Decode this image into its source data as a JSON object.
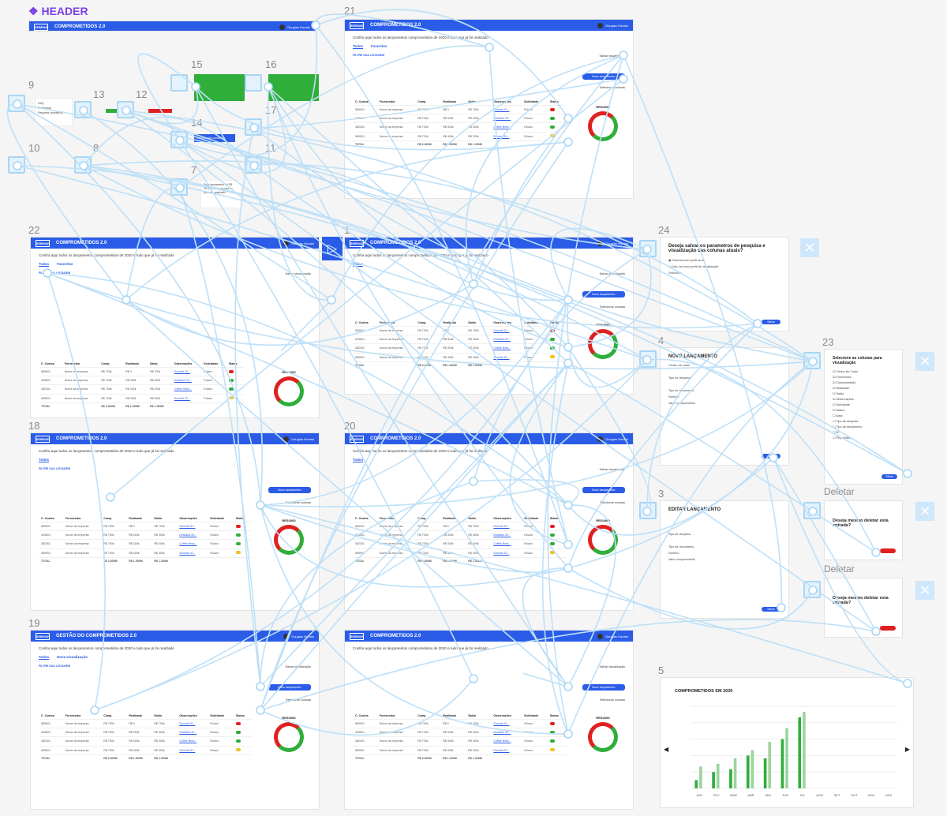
{
  "header_label": "HEADER",
  "frame_numbers": [
    "21",
    "22",
    "1",
    "24",
    "4",
    "23",
    "18",
    "20",
    "3",
    "19",
    "5",
    "9",
    "13",
    "12",
    "15",
    "16",
    "17",
    "14",
    "10",
    "8",
    "11",
    "7"
  ],
  "app": {
    "title": "COMPROMETIDOS 2.0",
    "title_alt": "GESTÃO DO COMPROMETIDOS 2.0",
    "logo": "SEBRAE",
    "user": "Douglas Honato",
    "intro": "Confira aqui todos os lançamentos comprometidos de 2020 e tudo que já foi realizado",
    "tabs": [
      "Todos",
      "Favoritos"
    ],
    "tab_alt": "Nova visualização",
    "filter_label": "FILTRE SUA LISTAGEM",
    "save_view": "Salvar visualização",
    "new_entry": "Novo lançamento",
    "select_columns": "Selecionar colunas",
    "filter_fields": [
      "Proprietários",
      "Status",
      "Tipo de despesa e lançamento"
    ],
    "chip_value": "64390x",
    "status_value": "Atendimento",
    "more_filters": "Filtros avançados",
    "columns": [
      "C. Custos",
      "Fornecedor",
      "Comp.",
      "Realizado",
      "Saldo",
      "Observações",
      "Solicitante",
      "Status"
    ],
    "rows": [
      {
        "cc": "589901",
        "forn": "Nome da empresa",
        "comp": "R$ 700k",
        "real": "R$ 0",
        "saldo": "R$ 700k",
        "obs": "Summit 20...",
        "sol": "Fulano",
        "status": "#e02020"
      },
      {
        "cc": "425601",
        "forn": "Nome da empresa",
        "comp": "R$ 700k",
        "real": "R$ 300k",
        "saldo": "R$ 400k",
        "obs": "Desafios 20...",
        "sol": "Fulano",
        "status": "#2fae3a"
      },
      {
        "cc": "382261",
        "forn": "Nome da empresa",
        "comp": "R$ 700k",
        "real": "R$ 300k",
        "saldo": "R$ 400k",
        "obs": "Coffee Brea...",
        "sol": "Fulano",
        "status": "#2fae3a"
      },
      {
        "cc": "589901",
        "forn": "Nome da empresa",
        "comp": "R$ 700k",
        "real": "R$ 400k",
        "saldo": "R$ 300k",
        "obs": "Summit 20...",
        "sol": "Fulano",
        "status": "#f0c020"
      }
    ],
    "total_label": "TOTAL",
    "totals": [
      "R$ 2.800M",
      "R$ 1.500M",
      "R$ 1.300M"
    ],
    "resumo": "RESUMO",
    "donut_label": "75%",
    "visao": "Visão Geral"
  },
  "dialogs": {
    "save_params": "Deseja salvar os parametros de pesquisa e visualização das colunas atuais?",
    "save_opt1": "Sobrescrever perfil atual",
    "save_opt2": "Criar um novo perfil de visualização",
    "select_label": "Selecione",
    "new_title": "NOVO LANÇAMENTO",
    "edit_title": "EDITAR LANÇAMENTO",
    "cc_label": "Centro de custo",
    "type_label": "Tipo de despesa",
    "doc_label": "Tipo de documento",
    "num_label": "Número",
    "value_label": "Valor comprometido",
    "save_btn": "Salvar",
    "cancel_btn": "Cancelar",
    "cols_title": "Selecione as colunas para visualização",
    "cols": [
      "Centro de Custo",
      "Fornecedor",
      "Comprometido",
      "Realizado",
      "Saldo",
      "Observações",
      "Solicitante",
      "Status",
      "Data",
      "Tipo de despesa",
      "Tipo de lançamento",
      "Nº",
      "Proprietário"
    ],
    "delete_section": "Deletar",
    "delete_q": "Deseja mesmo deletar esta entrada?",
    "chart_title": "COMPROMETIDOS EM 2020"
  },
  "components": {
    "menu9": [
      "FAQ",
      "Relatórios",
      "Reportar problema"
    ],
    "toast14": "Lançamento concluído",
    "note7": "Esse lançamento de R$ 00,00 está de acordo do previsto, realizado"
  },
  "colors": {
    "accent": "#2a5ce8",
    "wire": "#bfe0f7",
    "red": "#e02020",
    "green": "#2fae3a"
  },
  "chart_data": {
    "type": "bar",
    "title": "COMPROMETIDOS EM 2020",
    "categories": [
      "JAN",
      "FEV",
      "MAR",
      "ABR",
      "MAI",
      "JUN",
      "JUL",
      "AGO",
      "SET",
      "OUT",
      "NOV",
      "DEZ"
    ],
    "series": [
      {
        "values": [
          15,
          30,
          35,
          60,
          55,
          90,
          130,
          0,
          0,
          0,
          0,
          0
        ]
      },
      {
        "values": [
          40,
          45,
          55,
          70,
          85,
          110,
          140,
          0,
          0,
          0,
          0,
          0
        ]
      }
    ],
    "ylim": [
      0,
      150
    ]
  }
}
